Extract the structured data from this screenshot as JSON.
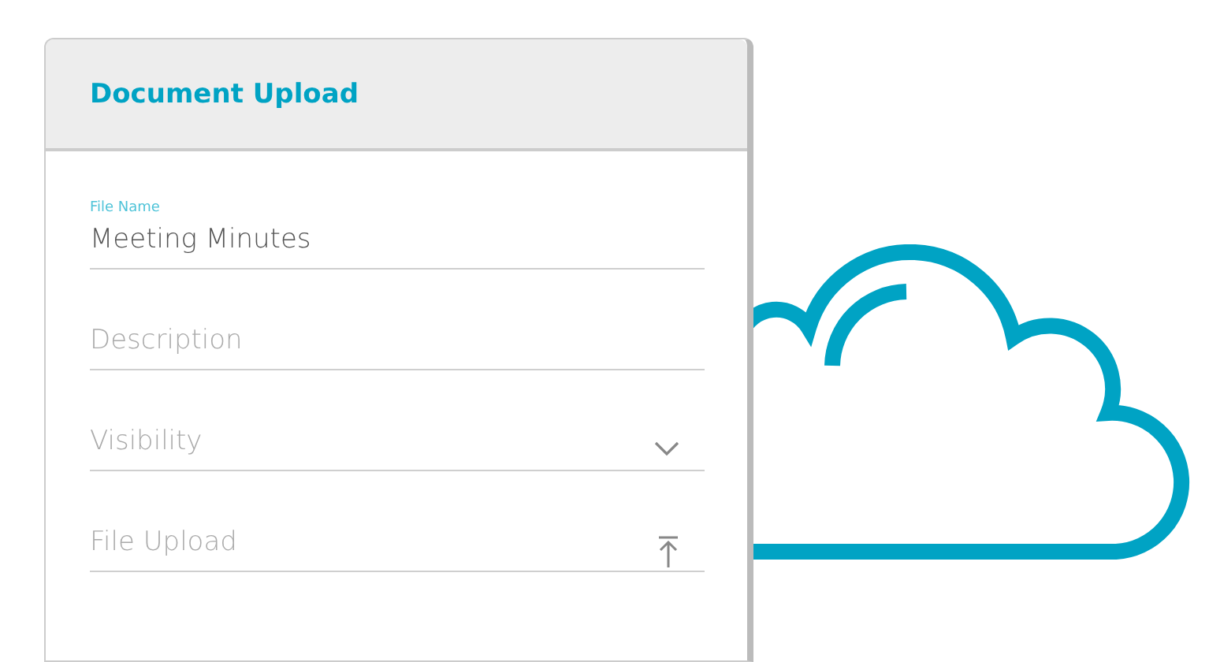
{
  "card": {
    "title": "Document Upload"
  },
  "fields": [
    {
      "kind": "text",
      "label": "File Name",
      "value": "Meeting Minutes"
    },
    {
      "kind": "text",
      "placeholder": "Description"
    },
    {
      "kind": "select",
      "placeholder": "Visibility"
    },
    {
      "kind": "upload",
      "placeholder": "File Upload"
    }
  ]
}
